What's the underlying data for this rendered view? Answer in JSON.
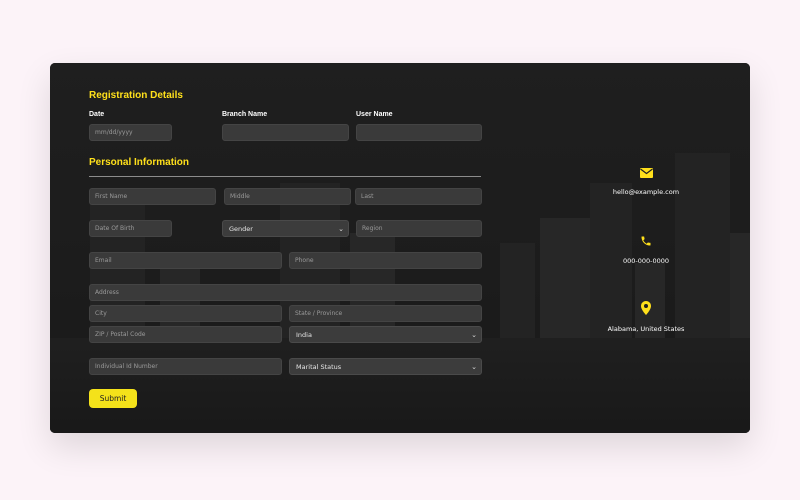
{
  "registration": {
    "heading": "Registration Details",
    "date_label": "Date",
    "date_placeholder": "mm/dd/yyyy",
    "branch_label": "Branch Name",
    "user_label": "User Name"
  },
  "personal": {
    "heading": "Personal Information",
    "first_name": "First Name",
    "middle": "Middle",
    "last": "Last",
    "dob": "Date Of Birth",
    "gender": "Gender",
    "region": "Region",
    "email": "Email",
    "phone": "Phone",
    "address": "Address",
    "city": "City",
    "state": "State / Province",
    "zip": "ZIP / Postal Code",
    "country": "India",
    "id_number": "Individual Id Number",
    "marital": "Marital Status",
    "submit": "Submit"
  },
  "contact": {
    "email": "hello@example.com",
    "phone": "000-000-0000",
    "location": "Alabama, United States"
  },
  "colors": {
    "accent": "#ffe01b",
    "button": "#f4e21a",
    "card": "#202020",
    "page": "#fcf3f8"
  },
  "icons": [
    "envelope-icon",
    "phone-icon",
    "location-pin-icon",
    "chevron-down-icon"
  ]
}
